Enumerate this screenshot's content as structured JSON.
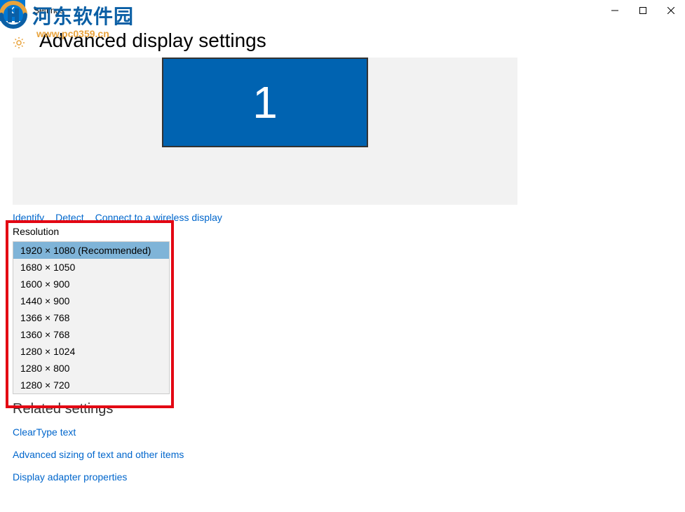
{
  "window": {
    "app_title": "Settings"
  },
  "page": {
    "title": "Advanced display settings"
  },
  "watermark": {
    "text": "河东软件园",
    "sub": "www.pc0359.cn"
  },
  "monitor": {
    "number": "1"
  },
  "actions": {
    "identify": "Identify",
    "detect": "Detect",
    "connect": "Connect to a wireless display"
  },
  "resolution": {
    "label": "Resolution",
    "selected_index": 0,
    "options": [
      "1920 × 1080 (Recommended)",
      "1680 × 1050",
      "1600 × 900",
      "1440 × 900",
      "1366 × 768",
      "1360 × 768",
      "1280 × 1024",
      "1280 × 800",
      "1280 × 720"
    ]
  },
  "related": {
    "heading": "Related settings",
    "links": [
      "ClearType text",
      "Advanced sizing of text and other items",
      "Display adapter properties"
    ]
  }
}
